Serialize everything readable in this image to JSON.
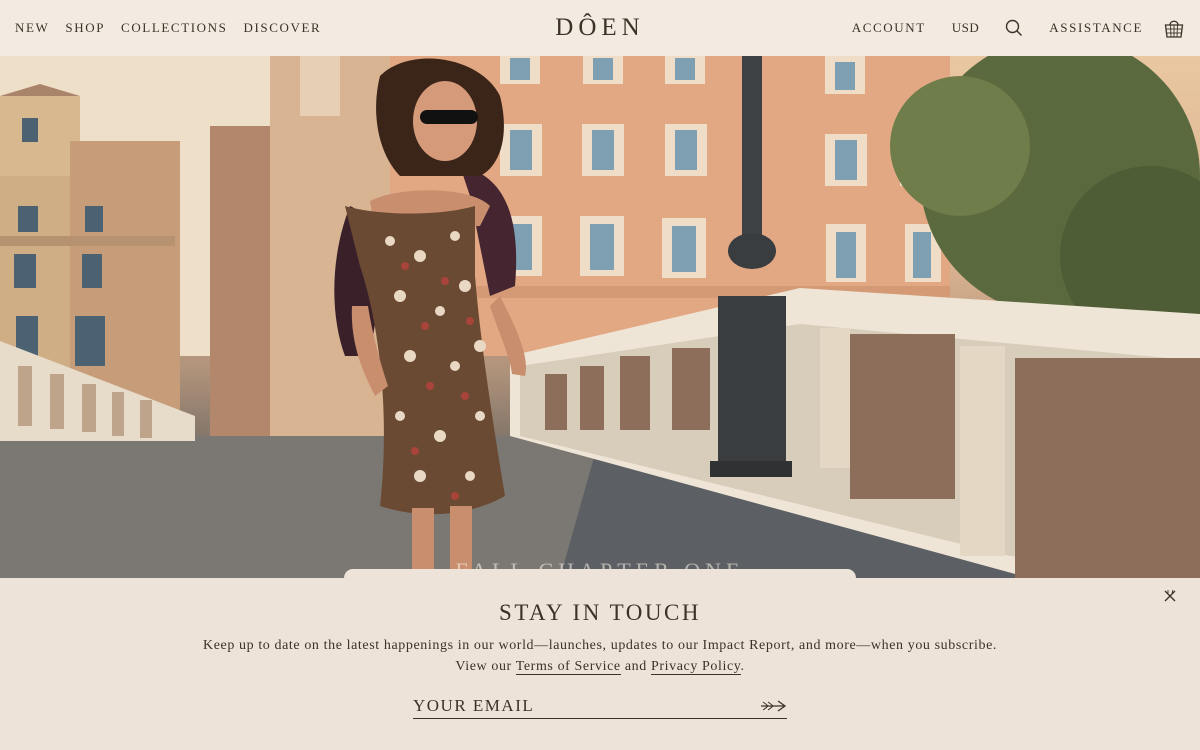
{
  "header": {
    "nav_left": [
      "NEW",
      "SHOP",
      "COLLECTIONS",
      "DISCOVER"
    ],
    "logo": "DÔEN",
    "nav_right": {
      "account": "ACCOUNT",
      "currency": "USD",
      "search_icon": "search-icon",
      "assistance": "ASSISTANCE",
      "cart_icon": "basket-icon"
    }
  },
  "hero": {
    "title": "FALL CHAPTER ONE"
  },
  "newsletter": {
    "title": "STAY IN TOUCH",
    "body_line1": "Keep up to date on the latest happenings in our world—launches, updates to our Impact Report, and more—when you subscribe.",
    "body_view": "View our",
    "terms_link": "Terms of Service",
    "and": "and",
    "privacy_link": "Privacy Policy",
    "period": ".",
    "email_placeholder": "YOUR EMAIL",
    "close_icon": "close-icon",
    "submit_icon": "arrow-right-icon"
  },
  "colors": {
    "text": "#3d3228",
    "header_bg": "#f2ebe2",
    "panel_bg": "#ede3d8"
  }
}
